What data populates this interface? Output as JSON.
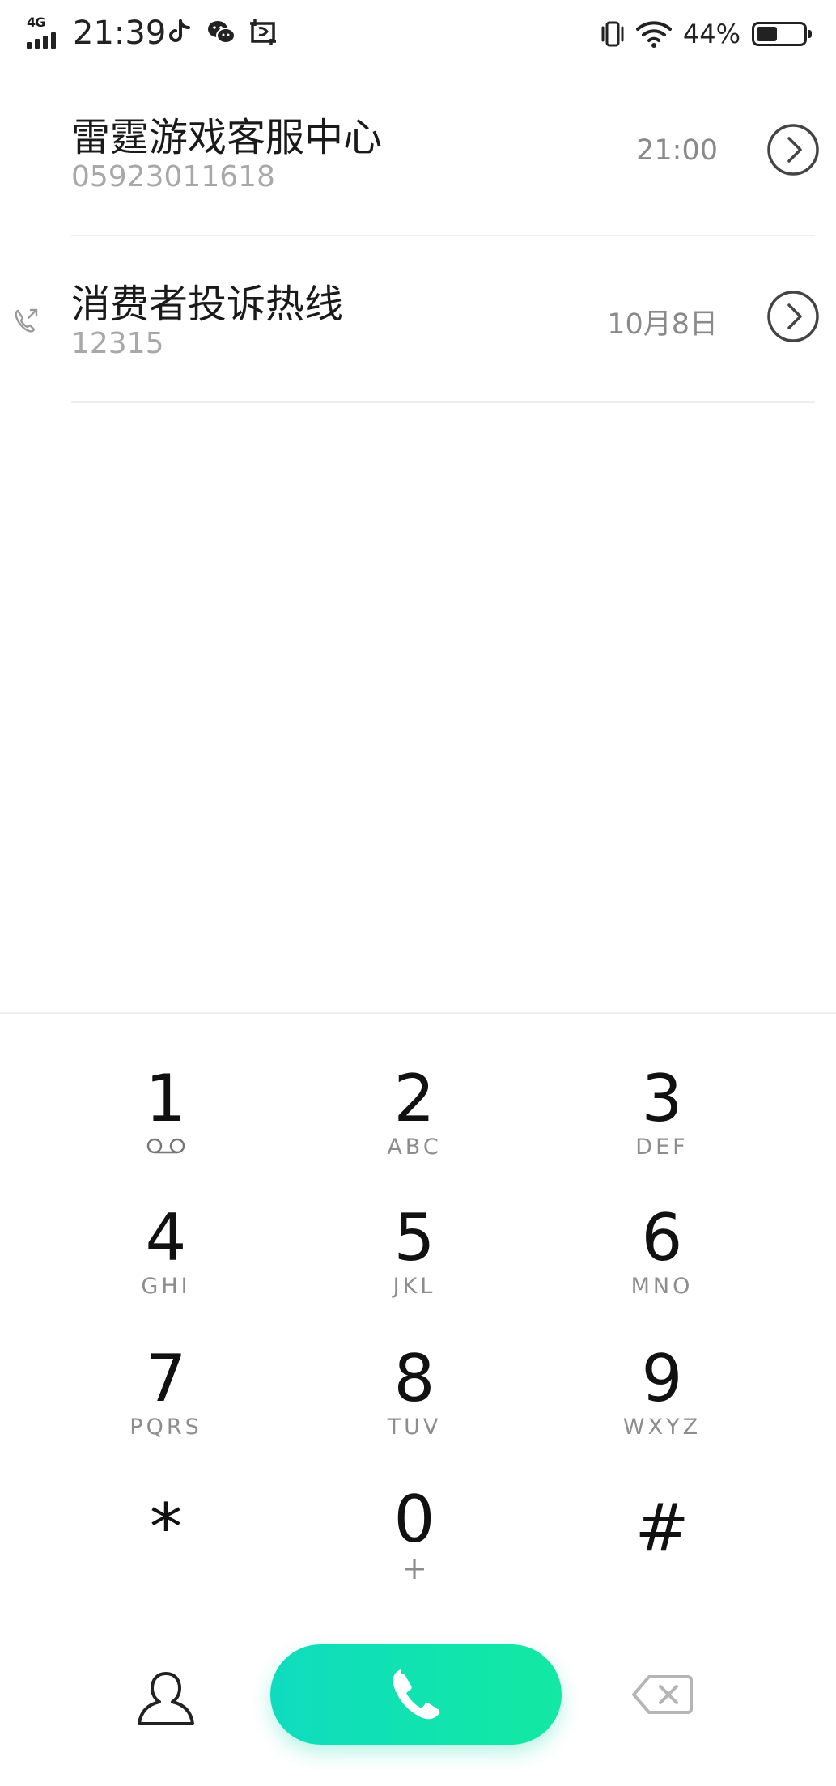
{
  "status_bar": {
    "network": "4G",
    "time": "21:39",
    "app_icons": [
      "tiktok-icon",
      "wechat-icon",
      "screenshot-icon"
    ],
    "vibrate_icon": "vibrate-icon",
    "wifi_icon": "wifi-icon",
    "battery_percent_text": "44%",
    "battery_level": 0.44
  },
  "call_log": [
    {
      "name": "雷霆游戏客服中心",
      "number": "05923011618",
      "time": "21:00",
      "type_icon": "",
      "detail_icon": "chevron-right-circle-icon"
    },
    {
      "name": "消费者投诉热线",
      "number": "12315",
      "time": "10月8日",
      "type_icon": "outgoing-call-icon",
      "detail_icon": "chevron-right-circle-icon"
    }
  ],
  "dialpad": {
    "keys": [
      {
        "digit": "1",
        "letters": "",
        "sub_icon": "voicemail-icon"
      },
      {
        "digit": "2",
        "letters": "ABC"
      },
      {
        "digit": "3",
        "letters": "DEF"
      },
      {
        "digit": "4",
        "letters": "GHI"
      },
      {
        "digit": "5",
        "letters": "JKL"
      },
      {
        "digit": "6",
        "letters": "MNO"
      },
      {
        "digit": "7",
        "letters": "PQRS"
      },
      {
        "digit": "8",
        "letters": "TUV"
      },
      {
        "digit": "9",
        "letters": "WXYZ"
      },
      {
        "digit": "*",
        "letters": ""
      },
      {
        "digit": "0",
        "letters": "+"
      },
      {
        "digit": "#",
        "letters": ""
      }
    ]
  },
  "actions": {
    "contacts_icon": "person-icon",
    "call_icon": "phone-icon",
    "backspace_icon": "backspace-icon",
    "call_colors": [
      "#0fdcbf",
      "#12e9a2"
    ]
  }
}
